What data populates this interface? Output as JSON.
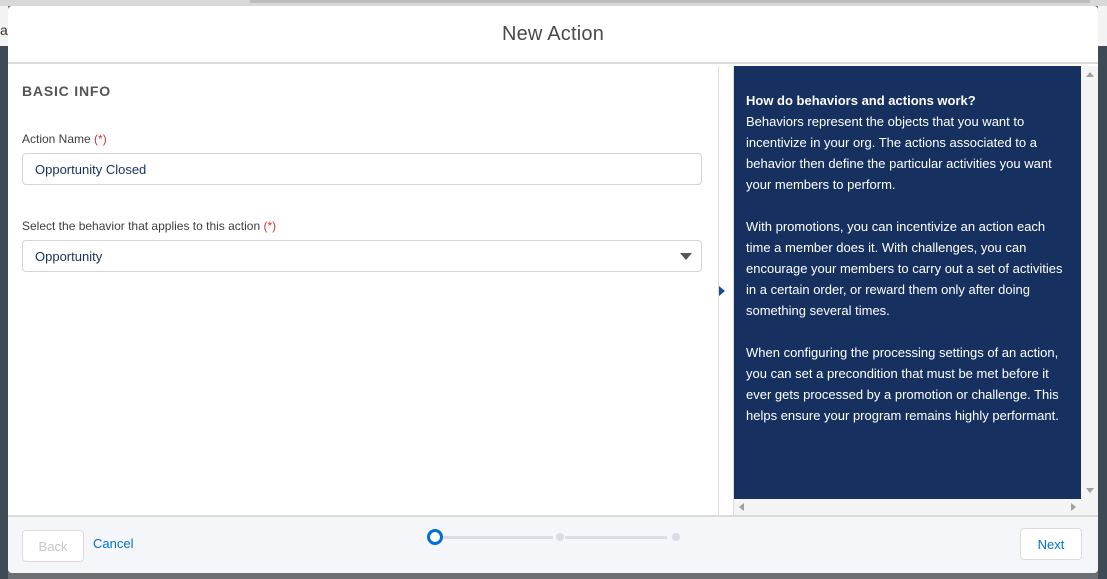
{
  "background": {
    "left_fragment": "a"
  },
  "modal": {
    "title": "New Action"
  },
  "form": {
    "section_title": "BASIC INFO",
    "action_name": {
      "label": "Action Name",
      "required_marker": "(*)",
      "value": "Opportunity Closed"
    },
    "behavior": {
      "label": "Select the behavior that applies to this action",
      "required_marker": "(*)",
      "selected": "Opportunity"
    }
  },
  "help": {
    "heading": "How do behaviors and actions work?",
    "paragraphs": [
      "Behaviors represent the objects that you want to incentivize in your org. The actions associated to a behavior then define the particular activities you want your members to perform.",
      "With promotions, you can incentivize an action each time a member does it. With challenges, you can encourage your members to carry out a set of activities in a certain order, or reward them only after doing something several times.",
      "When configuring the processing settings of an action, you can set a precondition that must be met before it ever gets processed by a promotion or challenge. This helps ensure your program remains highly performant."
    ],
    "background_color": "#163160"
  },
  "footer": {
    "back_label": "Back",
    "cancel_label": "Cancel",
    "next_label": "Next",
    "progress": {
      "total_steps": 3,
      "current_step": 1
    }
  },
  "colors": {
    "accent": "#0070d2",
    "required": "#c23934"
  }
}
